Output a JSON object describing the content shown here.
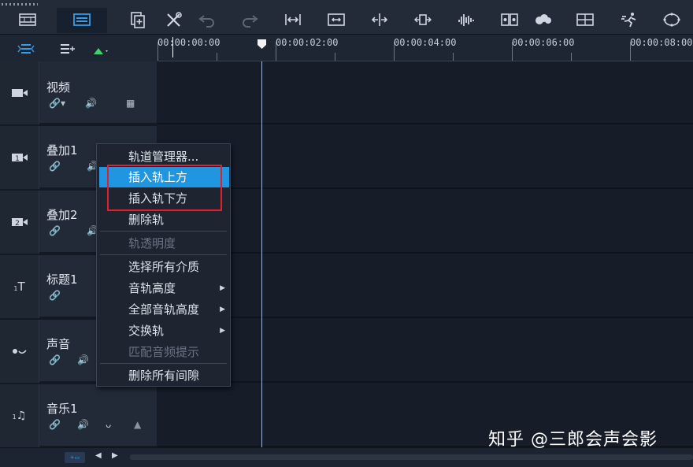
{
  "ruler": {
    "ticks": [
      "00:00:00:00",
      "00:00:02:00",
      "00:00:04:00",
      "00:00:06:00",
      "00:00:08:00"
    ]
  },
  "tracks": [
    {
      "name": "视频",
      "icon": "video-camera-icon"
    },
    {
      "name": "叠加1",
      "icon": "overlay-1-icon"
    },
    {
      "name": "叠加2",
      "icon": "overlay-2-icon"
    },
    {
      "name": "标题1",
      "icon": "title-icon"
    },
    {
      "name": "声音",
      "icon": "voice-icon"
    },
    {
      "name": "音乐1",
      "icon": "music-icon"
    }
  ],
  "context_menu": {
    "items": [
      {
        "label": "轨道管理器...",
        "enabled": true
      },
      {
        "label": "插入轨上方",
        "enabled": true,
        "highlighted": true
      },
      {
        "label": "插入轨下方",
        "enabled": true
      },
      {
        "label": "删除轨",
        "enabled": true
      },
      {
        "label": "轨透明度",
        "enabled": false
      },
      {
        "label": "选择所有介质",
        "enabled": true
      },
      {
        "label": "音轨高度",
        "enabled": true,
        "submenu": true
      },
      {
        "label": "全部音轨高度",
        "enabled": true,
        "submenu": true
      },
      {
        "label": "交换轨",
        "enabled": true,
        "submenu": true
      },
      {
        "label": "匹配音频提示",
        "enabled": false
      },
      {
        "label": "删除所有间隙",
        "enabled": true
      }
    ]
  },
  "watermark": "知乎 @三郎会声会影",
  "colors": {
    "highlight": "#2196e0",
    "annotation_box": "#e0202a",
    "accent_green": "#3fd26a"
  }
}
